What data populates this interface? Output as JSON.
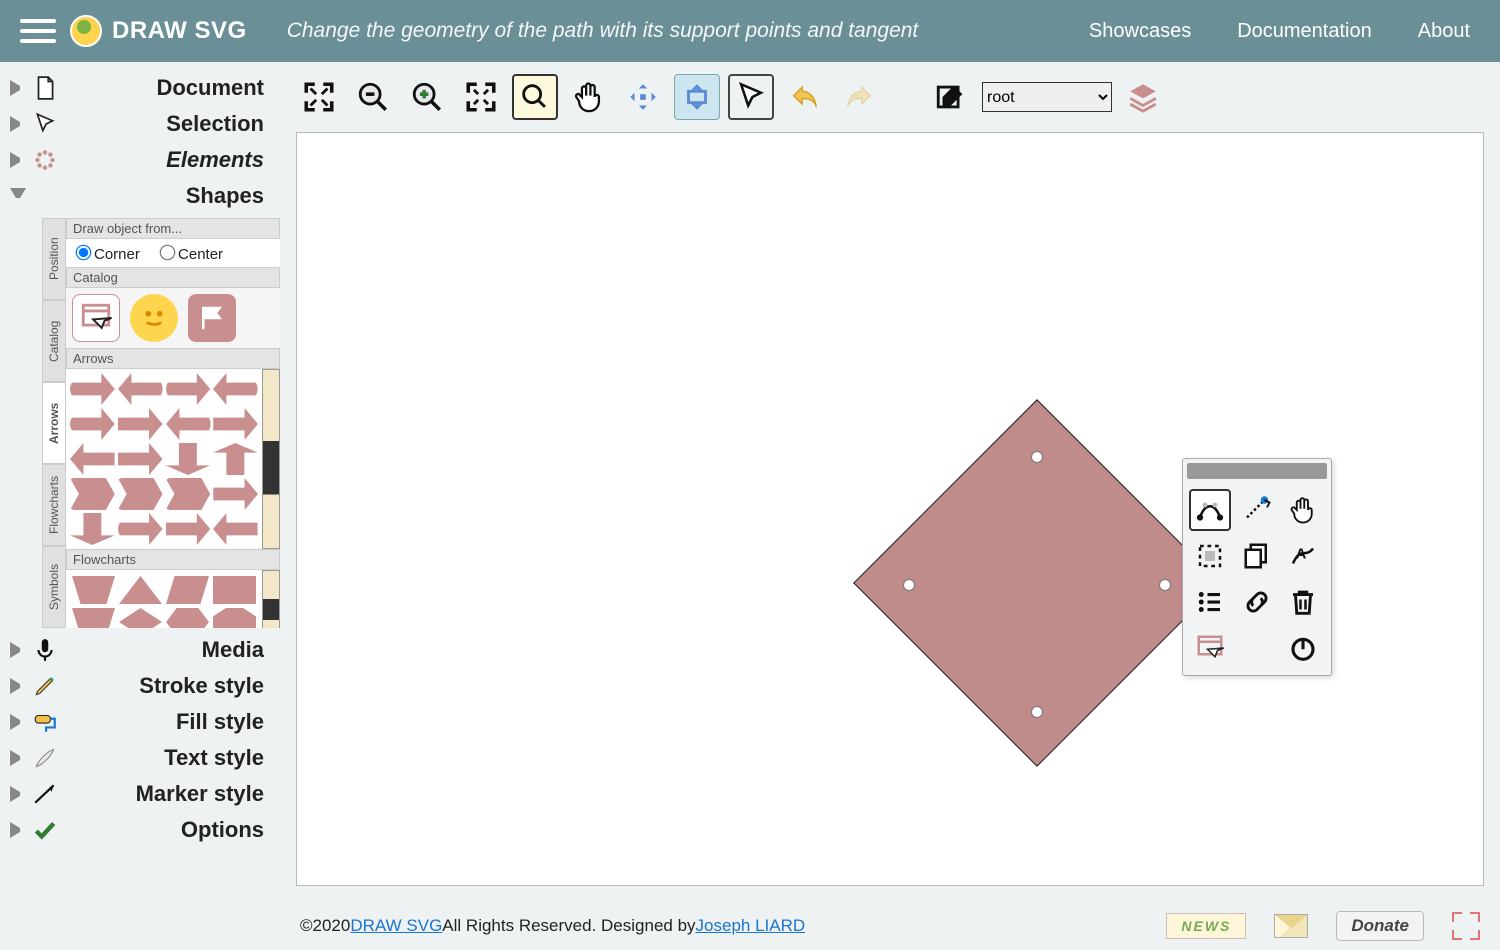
{
  "header": {
    "app_name": "DRAW SVG",
    "tagline": "Change the geometry of the path with its support points and tangent",
    "nav": {
      "showcases": "Showcases",
      "documentation": "Documentation",
      "about": "About"
    }
  },
  "sidebar": {
    "items": [
      {
        "label": "Document"
      },
      {
        "label": "Selection"
      },
      {
        "label": "Elements"
      },
      {
        "label": "Shapes"
      },
      {
        "label": "Media"
      },
      {
        "label": "Stroke style"
      },
      {
        "label": "Fill style"
      },
      {
        "label": "Text style"
      },
      {
        "label": "Marker style"
      },
      {
        "label": "Options"
      }
    ],
    "shapes": {
      "vtabs": [
        "Position",
        "Catalog",
        "Arrows",
        "Flowcharts",
        "Symbols"
      ],
      "draw_from_label": "Draw object from...",
      "radio_corner": "Corner",
      "radio_center": "Center",
      "catalog_label": "Catalog",
      "arrows_label": "Arrows",
      "flowcharts_label": "Flowcharts"
    }
  },
  "toolbar": {
    "root_select": "root"
  },
  "footer": {
    "copyright_prefix": "©2020 ",
    "site_link": "DRAW SVG",
    "rights": " All Rights Reserved. Designed by ",
    "author_link": "Joseph LIARD",
    "news": "NEWS",
    "donate": "Donate"
  },
  "colors": {
    "accent": "#6a8f97",
    "shape": "#c08b8b"
  }
}
